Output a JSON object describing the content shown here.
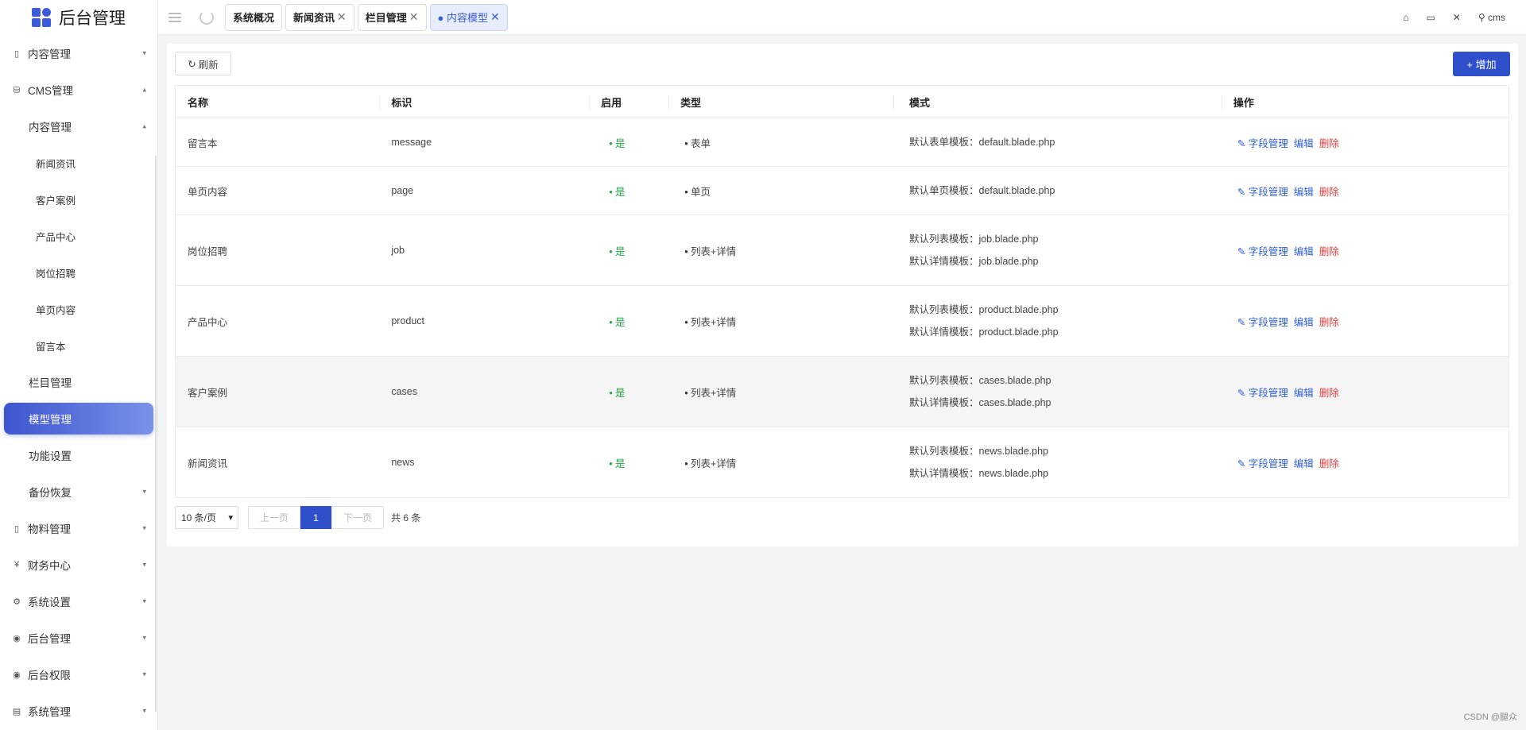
{
  "app": {
    "title": "后台管理"
  },
  "sidebar": {
    "items": [
      {
        "label": "内容管理",
        "icon": "file-icon",
        "level": 0,
        "caret": "▾"
      },
      {
        "label": "CMS管理",
        "icon": "database-icon",
        "level": 0,
        "caret": "▴"
      },
      {
        "label": "内容管理",
        "level": 1,
        "caret": "▴"
      },
      {
        "label": "新闻资讯",
        "level": 2
      },
      {
        "label": "客户案例",
        "level": 2
      },
      {
        "label": "产品中心",
        "level": 2
      },
      {
        "label": "岗位招聘",
        "level": 2
      },
      {
        "label": "单页内容",
        "level": 2
      },
      {
        "label": "留言本",
        "level": 2
      },
      {
        "label": "栏目管理",
        "level": 1
      },
      {
        "label": "模型管理",
        "level": 1,
        "active": true
      },
      {
        "label": "功能设置",
        "level": 1
      },
      {
        "label": "备份恢复",
        "level": 1,
        "caret": "▾"
      },
      {
        "label": "物料管理",
        "icon": "file-icon",
        "level": 0,
        "caret": "▾"
      },
      {
        "label": "财务中心",
        "icon": "yen-icon",
        "level": 0,
        "caret": "▾"
      },
      {
        "label": "系统设置",
        "icon": "gear-icon",
        "level": 0,
        "caret": "▾"
      },
      {
        "label": "后台管理",
        "icon": "user-circle-icon",
        "level": 0,
        "caret": "▾"
      },
      {
        "label": "后台权限",
        "icon": "user-circle-icon",
        "level": 0,
        "caret": "▾"
      },
      {
        "label": "系统管理",
        "icon": "chart-icon",
        "level": 0,
        "caret": "▾"
      }
    ]
  },
  "header": {
    "tabs": [
      {
        "label": "系统概况",
        "closable": false
      },
      {
        "label": "新闻资讯",
        "closable": true
      },
      {
        "label": "栏目管理",
        "closable": true
      },
      {
        "label": "● 内容模型",
        "closable": true,
        "active": true
      }
    ],
    "user": "cms"
  },
  "toolbar": {
    "refresh_label": "刷新",
    "add_label": "+ 增加"
  },
  "table": {
    "columns": [
      "名称",
      "标识",
      "启用",
      "类型",
      "模式",
      "操作"
    ],
    "rows": [
      {
        "name": "留言本",
        "key": "message",
        "enabled": "是",
        "type": "表单",
        "modes": [
          "默认表单模板：default.blade.php"
        ]
      },
      {
        "name": "单页内容",
        "key": "page",
        "enabled": "是",
        "type": "单页",
        "modes": [
          "默认单页模板：default.blade.php"
        ]
      },
      {
        "name": "岗位招聘",
        "key": "job",
        "enabled": "是",
        "type": "列表+详情",
        "modes": [
          "默认列表模板：job.blade.php",
          "默认详情模板：job.blade.php"
        ]
      },
      {
        "name": "产品中心",
        "key": "product",
        "enabled": "是",
        "type": "列表+详情",
        "modes": [
          "默认列表模板：product.blade.php",
          "默认详情模板：product.blade.php"
        ]
      },
      {
        "name": "客户案例",
        "key": "cases",
        "enabled": "是",
        "type": "列表+详情",
        "modes": [
          "默认列表模板：cases.blade.php",
          "默认详情模板：cases.blade.php"
        ]
      },
      {
        "name": "新闻资讯",
        "key": "news",
        "enabled": "是",
        "type": "列表+详情",
        "modes": [
          "默认列表模板：news.blade.php",
          "默认详情模板：news.blade.php"
        ]
      }
    ],
    "actions": {
      "fields": "字段管理",
      "edit": "编辑",
      "delete": "删除"
    }
  },
  "pagination": {
    "page_size": "10 条/页",
    "prev": "上一页",
    "current": "1",
    "next": "下一页",
    "total": "共 6 条"
  },
  "footer": {
    "note": "CSDN @腿众"
  },
  "colors": {
    "primary": "#2f4fcb",
    "success": "#22a845",
    "danger": "#e03e3e",
    "link": "#2f5fd0"
  }
}
